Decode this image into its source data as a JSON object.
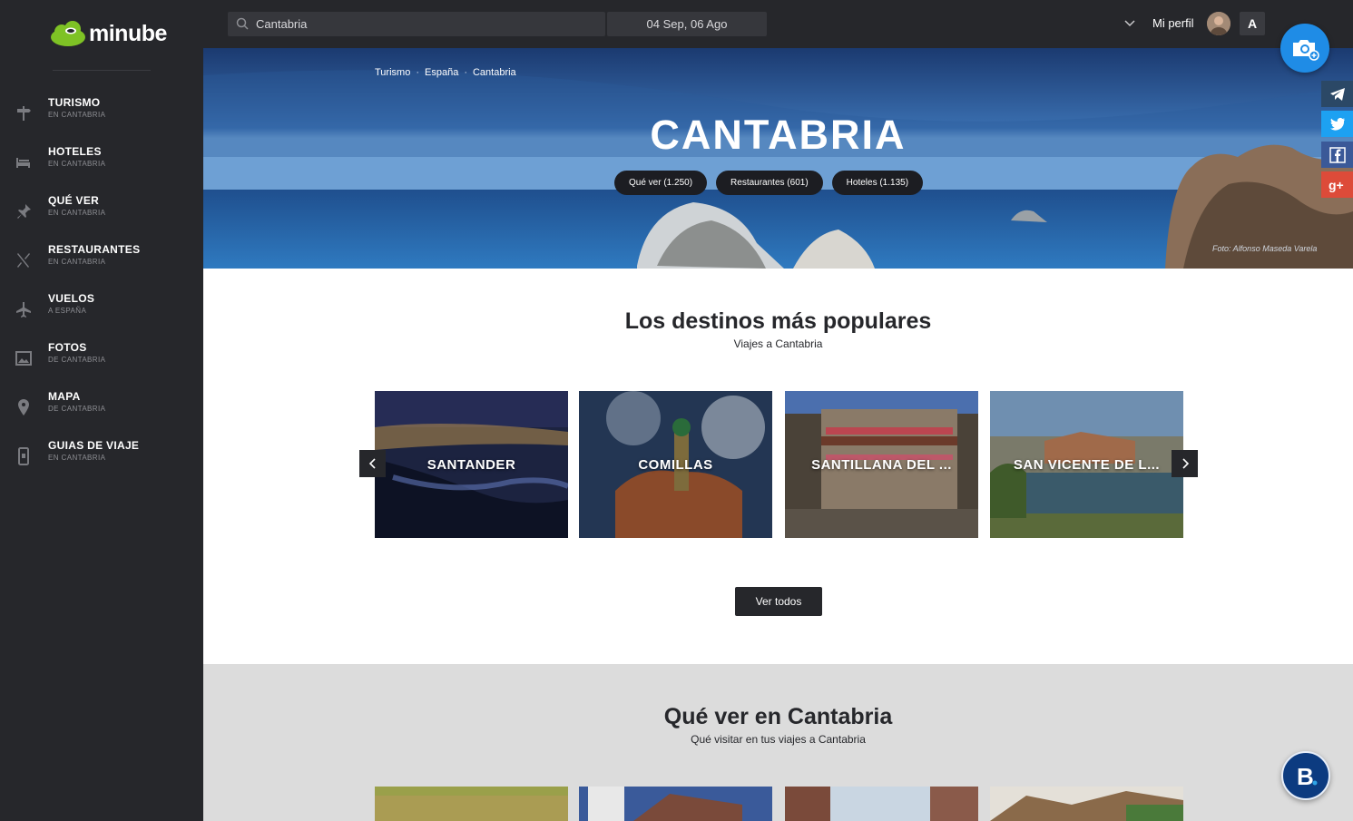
{
  "brand": {
    "name": "minube"
  },
  "sidebar": {
    "items": [
      {
        "label": "TURISMO",
        "sub": "EN CANTABRIA",
        "icon": "signpost-icon"
      },
      {
        "label": "HOTELES",
        "sub": "EN CANTABRIA",
        "icon": "bed-icon"
      },
      {
        "label": "QUÉ VER",
        "sub": "EN CANTABRIA",
        "icon": "pin-icon"
      },
      {
        "label": "RESTAURANTES",
        "sub": "EN CANTABRIA",
        "icon": "cutlery-icon"
      },
      {
        "label": "VUELOS",
        "sub": "A ESPAÑA",
        "icon": "plane-icon"
      },
      {
        "label": "FOTOS",
        "sub": "DE CANTABRIA",
        "icon": "photo-icon"
      },
      {
        "label": "MAPA",
        "sub": "DE CANTABRIA",
        "icon": "map-pin-icon"
      },
      {
        "label": "GUIAS DE VIAJE",
        "sub": "EN CANTABRIA",
        "icon": "phone-icon"
      }
    ]
  },
  "topbar": {
    "search_value": "Cantabria",
    "dates": "04 Sep, 06 Ago",
    "profile_label": "Mi perfil",
    "lang_button": "A"
  },
  "hero": {
    "breadcrumb": [
      "Turismo",
      "España",
      "Cantabria"
    ],
    "title": "CANTABRIA",
    "pills": [
      "Qué ver (1.250)",
      "Restaurantes (601)",
      "Hoteles (1.135)"
    ],
    "photo_credit": "Foto: Alfonso Maseda Varela"
  },
  "popular": {
    "title": "Los destinos más populares",
    "subtitle": "Viajes a Cantabria",
    "cards": [
      "SANTANDER",
      "COMILLAS",
      "SANTILLANA DEL ...",
      "SAN VICENTE DE L..."
    ],
    "see_all": "Ver todos"
  },
  "que_ver": {
    "title": "Qué ver en Cantabria",
    "subtitle": "Qué visitar en tus viajes a Cantabria"
  },
  "colors": {
    "sidebar_bg": "#26272b",
    "accent_blue": "#1f8ce6",
    "booking_blue": "#0c3b80"
  }
}
